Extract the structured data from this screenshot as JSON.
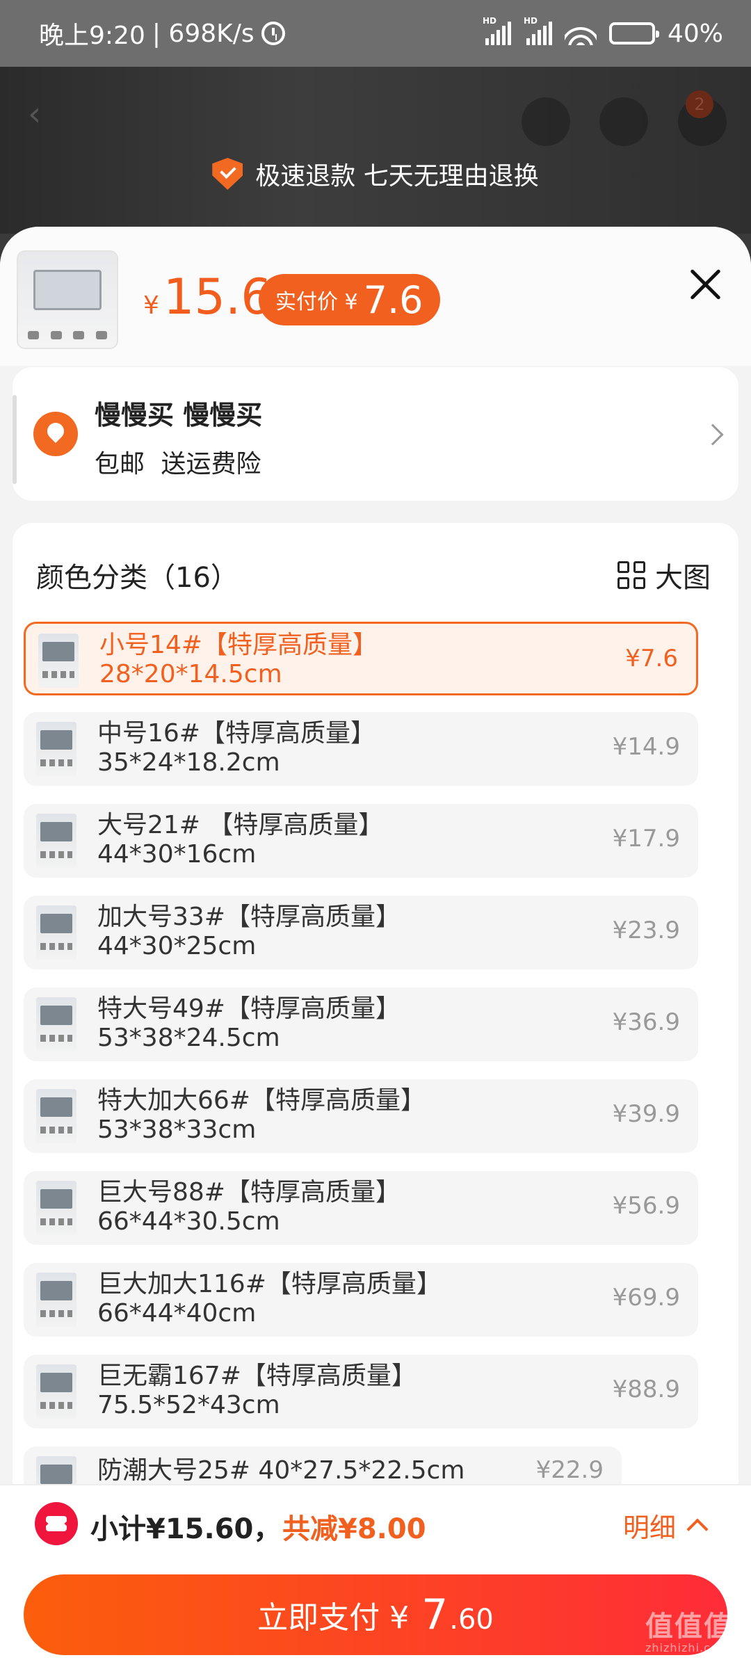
{
  "status_bar": {
    "time": "晚上9:20",
    "speed": "| 698K/s",
    "battery": "40%",
    "network_label": "HD"
  },
  "guarantee": {
    "text": "极速退款 七天无理由退换"
  },
  "background": {
    "cart_badge": "2"
  },
  "product": {
    "price_symbol": "¥",
    "price": "15.6",
    "real_price_label": "实付价 ¥",
    "real_price": "7.6"
  },
  "address": {
    "name": "慢慢买 慢慢买",
    "sub": "包邮 送运费险"
  },
  "category": {
    "title": "颜色分类（16）",
    "big_view_label": "大图"
  },
  "items": [
    {
      "name": "小号14#【特厚高质量】",
      "dims": "28*20*14.5cm",
      "price": "¥7.6",
      "selected": true
    },
    {
      "name": "中号16#【特厚高质量】",
      "dims": "35*24*18.2cm",
      "price": "¥14.9",
      "selected": false
    },
    {
      "name": "大号21# 【特厚高质量】",
      "dims": "44*30*16cm",
      "price": "¥17.9",
      "selected": false
    },
    {
      "name": "加大号33#【特厚高质量】",
      "dims": "44*30*25cm",
      "price": "¥23.9",
      "selected": false
    },
    {
      "name": "特大号49#【特厚高质量】",
      "dims": "53*38*24.5cm",
      "price": "¥36.9",
      "selected": false
    },
    {
      "name": "特大加大66#【特厚高质量】",
      "dims": "53*38*33cm",
      "price": "¥39.9",
      "selected": false
    },
    {
      "name": "巨大号88#【特厚高质量】",
      "dims": "66*44*30.5cm",
      "price": "¥56.9",
      "selected": false
    },
    {
      "name": "巨大加大116#【特厚高质量】",
      "dims": "66*44*40cm",
      "price": "¥69.9",
      "selected": false
    },
    {
      "name": "巨无霸167#【特厚高质量】",
      "dims": "75.5*52*43cm",
      "price": "¥88.9",
      "selected": false
    },
    {
      "name": "防潮大号25# 40*27.5*22.5cm",
      "dims": "",
      "price": "¥22.9",
      "selected": false
    }
  ],
  "bottom": {
    "subtotal": "小计¥15.60，",
    "discount": "共减¥8.00",
    "detail": "明细",
    "pay_label": "立即支付 ¥",
    "pay_int": "7",
    "pay_dec": ".60"
  },
  "watermark": {
    "text": "值值值",
    "sub": "zhizhizhi.com"
  },
  "colors": {
    "accent": "#f2601f",
    "pay_gradient_start": "#fb5e0c",
    "pay_gradient_end": "#fe2c38",
    "coupon": "#f0153d"
  }
}
